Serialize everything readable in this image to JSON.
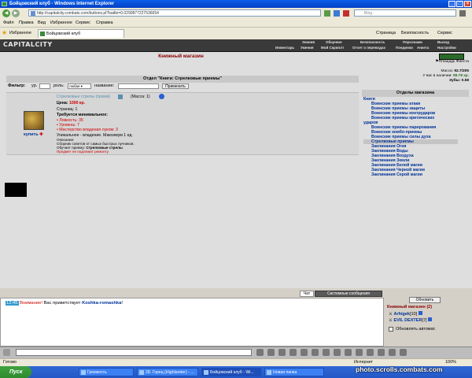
{
  "window": {
    "title": "Бойцовский клуб - Windows Internet Explorer"
  },
  "browser": {
    "url": "http://capitalcity.combats.com/buttons.pl?battle=0.0290877227536654",
    "search_placeholder": "Bing",
    "menu": [
      "Файл",
      "Правка",
      "Вид",
      "Избранное",
      "Сервис",
      "Справка"
    ],
    "favorites_label": "Избранное",
    "tab_title": "Бойцовский клуб",
    "toolbar_right": [
      "Страница",
      "Безопасность",
      "Сервис"
    ]
  },
  "site": {
    "logo": "CAPITALCITY",
    "nav_top": [
      "Знания",
      "Общение",
      "Безопасность",
      "Персонажи",
      "Выход"
    ],
    "nav_bottom": [
      "Инвентарь",
      "Умения",
      "Мой Скриплт",
      "Отчет о переводах",
      "Поединки",
      "Анкета",
      "Настройки"
    ]
  },
  "shop": {
    "title": "Книжный магазин",
    "location": "Площадь Фиеста",
    "mass_label": "Масса:",
    "mass_value": "92.7/205",
    "money_label": "У вас в наличии:",
    "money_value": "98.78 кр.",
    "teeth_label": "Зубы:",
    "teeth_value": "0.58",
    "department_header": "Отдел \"Книги: Стрелковые приемы\"",
    "filter": {
      "label": "Фильтр:",
      "level_label": "ур.",
      "role_label": "роль:",
      "role_value": "любая",
      "name_label": "название:",
      "apply_button": "Применить"
    }
  },
  "item": {
    "name": "Стрелковые стрелы (прием)",
    "mass": "(Масса: 1)",
    "price_label": "Цена:",
    "price_value": "1000 кр.",
    "pages": "Страниц: 1",
    "requirements_title": "Требуется минимальное:",
    "req_agility": "• Ловкость: 35",
    "req_level": "• Уровень: 7",
    "req_bow": "• Мастерство владения луком: 3",
    "unique": "Уникальное - владение. Максимум 1 ед.",
    "description_label": "Описание:",
    "description": "Сборник советов от самых быстрых лучников.",
    "teaches_label": "Обучает приему:",
    "teaches_value": "Стрелковые стрелы",
    "no_repair": "Предмет не подлежит ремонту",
    "buy_label": "купить"
  },
  "sidebar": {
    "title": "Отделы магазина",
    "items": [
      {
        "label": "Книги",
        "indent": 0
      },
      {
        "label": "Воинские приемы атаки",
        "indent": 1
      },
      {
        "label": "Воинские приемы защиты",
        "indent": 1
      },
      {
        "label": "Воинские приемы контрударов",
        "indent": 1
      },
      {
        "label": "Воинские приемы критических",
        "indent": 1
      },
      {
        "label": "ударов",
        "indent": 0
      },
      {
        "label": "Воинские приемы парирования",
        "indent": 1
      },
      {
        "label": "Воинские комбо-приемы",
        "indent": 1
      },
      {
        "label": "Воинские приемы силы духа",
        "indent": 1
      },
      {
        "label": "Стрелковые приемы",
        "indent": 1,
        "selected": true
      },
      {
        "label": "Заклинания Огня",
        "indent": 1
      },
      {
        "label": "Заклинания Воды",
        "indent": 1
      },
      {
        "label": "Заклинания Воздуха",
        "indent": 1
      },
      {
        "label": "Заклинания Земли",
        "indent": 1
      },
      {
        "label": "Заклинания Белой магии",
        "indent": 1
      },
      {
        "label": "Заклинания Черной магии",
        "indent": 1
      },
      {
        "label": "Заклинания Серой магии",
        "indent": 1
      }
    ]
  },
  "chat": {
    "tab_chat": "Чат",
    "tab_system": "Системные сообщения",
    "message": {
      "time": "12:45",
      "attention": "Внимание!",
      "text": "Вас приветствует",
      "user": "Koshka-romashka",
      "end": "!"
    }
  },
  "online": {
    "refresh_button": "Обновить",
    "title": "Книжный магазин",
    "count": "(2)",
    "users": [
      {
        "name": "Arhigek",
        "level": "[10]"
      },
      {
        "name": "EVIL DEXTER",
        "level": "[7]"
      }
    ],
    "auto_refresh_label": "Обновлять автомат."
  },
  "statusbar": {
    "left": "Готово",
    "zone": "Интернет",
    "zoom": "100%"
  },
  "taskbar": {
    "start": "Пуск",
    "tasks": [
      "Громкость",
      "28. Горец (Highlander) - ...",
      "Бойцовский клуб - Wi...",
      "Новая папка"
    ]
  },
  "watermark": "photo.scrolls.combats.com",
  "colors": {
    "accent_red": "#8b0000",
    "link_blue": "#003399",
    "panel": "#dedede"
  }
}
